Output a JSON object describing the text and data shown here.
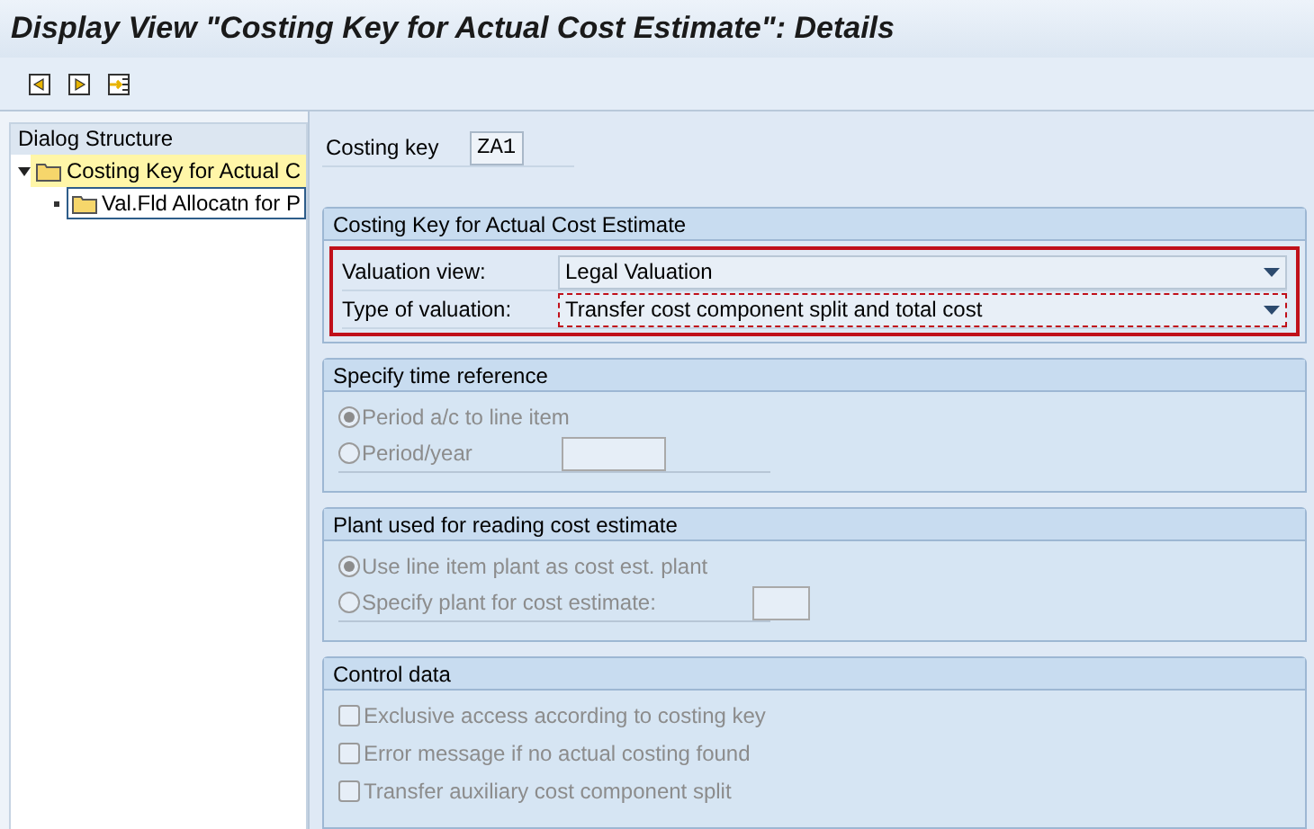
{
  "window": {
    "title": "Display View \"Costing Key for Actual Cost Estimate\": Details"
  },
  "toolbar": [
    {
      "kind": "prev"
    },
    {
      "kind": "next"
    },
    {
      "kind": "other"
    }
  ],
  "dialog_structure": {
    "title": "Dialog Structure",
    "items": [
      {
        "label": "Costing Key for Actual C",
        "selected": true,
        "focused": false,
        "expanded": true,
        "children": [
          {
            "label": "Val.Fld Allocatn for P",
            "selected": false,
            "focused": true
          }
        ]
      }
    ]
  },
  "costing_key": {
    "label": "Costing key",
    "value": "ZA1"
  },
  "main_group": {
    "title": "Costing Key for Actual Cost Estimate",
    "highlighted": true,
    "fields": [
      {
        "label": "Valuation view:",
        "value": "Legal Valuation",
        "focused": false
      },
      {
        "label": "Type of valuation:",
        "value": "Transfer cost component split and total cost",
        "focused": true
      }
    ]
  },
  "groups": [
    {
      "title": "Specify time reference",
      "options": [
        {
          "kind": "radio",
          "label": "Period a/c to line item",
          "selected": true,
          "disabled": true,
          "has_field": false
        },
        {
          "kind": "radio",
          "label": "Period/year",
          "selected": false,
          "disabled": true,
          "has_field": true
        }
      ]
    },
    {
      "title": "Plant used for reading cost estimate",
      "options": [
        {
          "kind": "radio",
          "label": "Use line item plant as cost est. plant",
          "selected": true,
          "disabled": true,
          "has_field": false
        },
        {
          "kind": "radio",
          "label": "Specify plant for cost estimate:",
          "selected": false,
          "disabled": true,
          "has_field": true
        }
      ]
    },
    {
      "title": "Control data",
      "options": [
        {
          "kind": "checkbox",
          "label": "Exclusive access according to costing key",
          "checked": false,
          "disabled": true
        },
        {
          "kind": "checkbox",
          "label": "Error message if no actual costing found",
          "checked": false,
          "disabled": true
        },
        {
          "kind": "checkbox",
          "label": "Transfer auxiliary cost component split",
          "checked": false,
          "disabled": true
        }
      ]
    }
  ]
}
